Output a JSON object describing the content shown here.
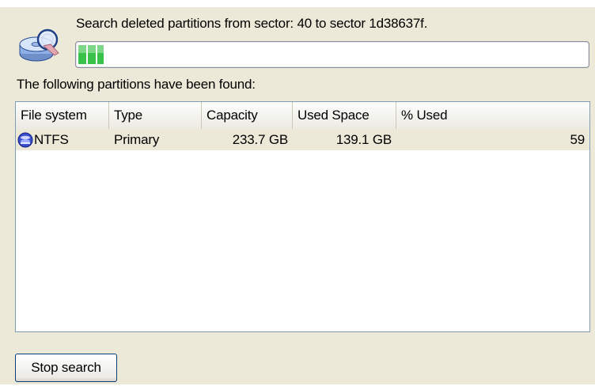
{
  "search": {
    "status_text": "Search deleted partitions from sector: 40 to sector 1d38637f.",
    "progress_fraction": 0.05
  },
  "results": {
    "heading": "The following partitions have been found:",
    "columns": [
      "File system",
      "Type",
      "Capacity",
      "Used Space",
      "% Used"
    ],
    "rows": [
      {
        "file_system": "NTFS",
        "type": "Primary",
        "capacity": "233.7 GB",
        "used_space": "139.1 GB",
        "percent_used": "59",
        "icon": "ntfs-drive-icon"
      }
    ]
  },
  "actions": {
    "stop_label": "Stop search"
  },
  "colors": {
    "dialog_background": "#ece9d8",
    "progress_green": "#39c24a",
    "selected_row": "#ece9d8"
  }
}
